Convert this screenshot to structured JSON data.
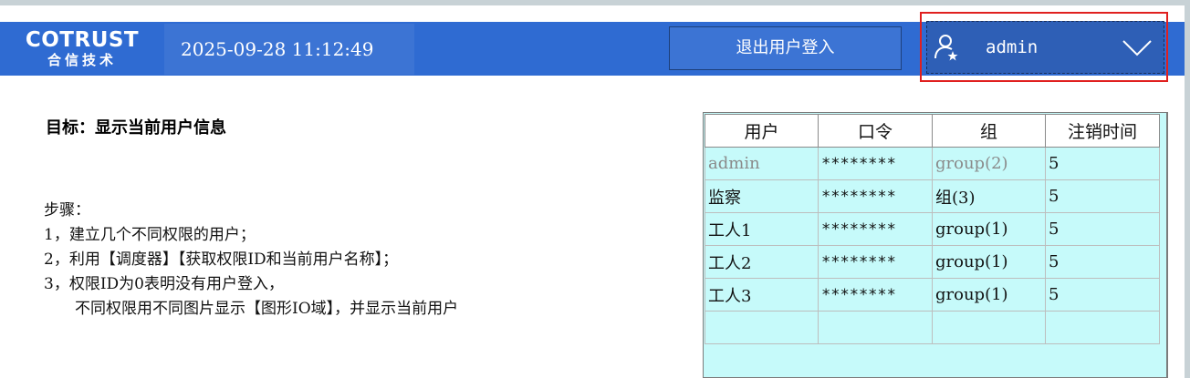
{
  "header": {
    "logo_main": "COTRUST",
    "logo_sub": "合信技术",
    "datetime": "2025-09-28 11:12:49",
    "logout_label": "退出用户登入",
    "current_user": "admin"
  },
  "content": {
    "goal": "目标：显示当前用户信息",
    "steps_title": "步骤：",
    "steps": [
      "1，建立几个不同权限的用户；",
      "2，利用【调度器】【获取权限ID和当前用户名称】；",
      "3，权限ID为0表明没有用户登入，",
      "不同权限用不同图片显示【图形IO域】，并显示当前用户"
    ]
  },
  "user_table": {
    "headers": [
      "用户",
      "口令",
      "组",
      "注销时间"
    ],
    "rows": [
      [
        "admin",
        "********",
        "group(2)",
        "5"
      ],
      [
        "监察",
        "********",
        "组(3)",
        "5"
      ],
      [
        "工人1",
        "********",
        "group(1)",
        "5"
      ],
      [
        "工人2",
        "********",
        "group(1)",
        "5"
      ],
      [
        "工人3",
        "********",
        "group(1)",
        "5"
      ],
      [
        "",
        "",
        "",
        ""
      ]
    ]
  },
  "colors": {
    "header_blue": "#2f6bd2",
    "highlight_red": "#e0201f",
    "table_cyan": "#c6fafa"
  }
}
